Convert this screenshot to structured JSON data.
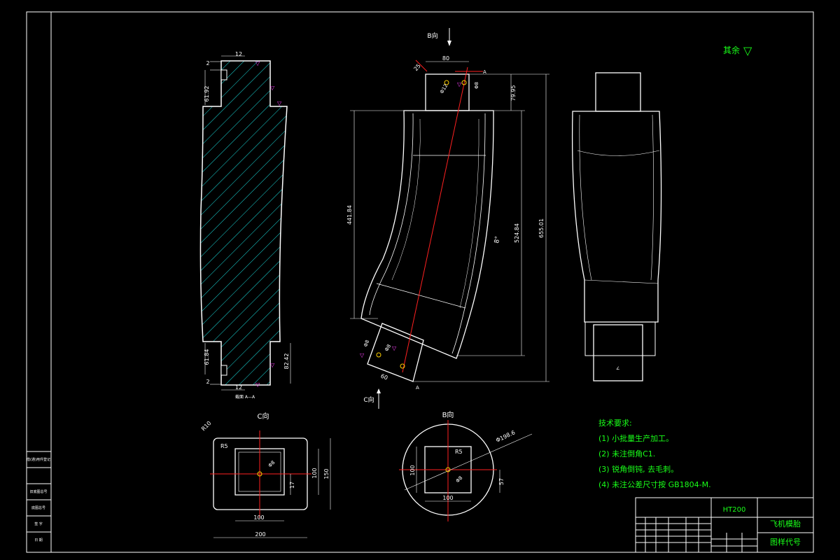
{
  "views": {
    "section_caption": "截面 A—A",
    "b_arrow_label": "B向",
    "c_arrow_label": "C向",
    "c_view_title": "C向",
    "b_view_title": "B向",
    "section_mark": "A",
    "angle_label": "8°"
  },
  "dimensions": {
    "top_width": "80",
    "height_ab": "25",
    "height_79": "79.95",
    "height_441": "441.84",
    "height_524": "524.84",
    "height_655": "655.01",
    "bottom_width": "60",
    "section_12_top": "12",
    "section_12_bottom": "12",
    "section_2_top": "2",
    "section_2_bottom": "2",
    "section_61_top": "61.92",
    "section_61_bottom": "61.84",
    "section_82": "82.42",
    "phi_12": "Φ12",
    "phi_8": "Φ8",
    "phi_8b": "Φ8",
    "c_r10": "R10",
    "c_r5": "R5",
    "c_100_w": "100",
    "c_100_h": "100",
    "c_150": "150",
    "c_200": "200",
    "c_17": "17",
    "c_phi8": "Φ8",
    "b_phi": "Φ198.6",
    "b_r5": "R5",
    "b_100_w": "100",
    "b_100_h": "100",
    "b_57": "57",
    "b_phi8": "Φ8"
  },
  "roughness": {
    "label": "其余"
  },
  "tech_requirements": {
    "title": "技术要求:",
    "items": [
      "(1) 小批量生产加工。",
      "(2) 未注倒角C1.",
      "(3) 锐角倒钝, 去毛刺。",
      "(4) 未注公差尺寸按 GB1804-M."
    ]
  },
  "title_block": {
    "material": "HT200",
    "part_name": "飞机模胎",
    "drawing_code": "图样代号"
  },
  "left_strip": {
    "cells": [
      "借(通)用件登记",
      "",
      "旧底图总号",
      "底图总号",
      "签 字",
      "日 期"
    ]
  }
}
